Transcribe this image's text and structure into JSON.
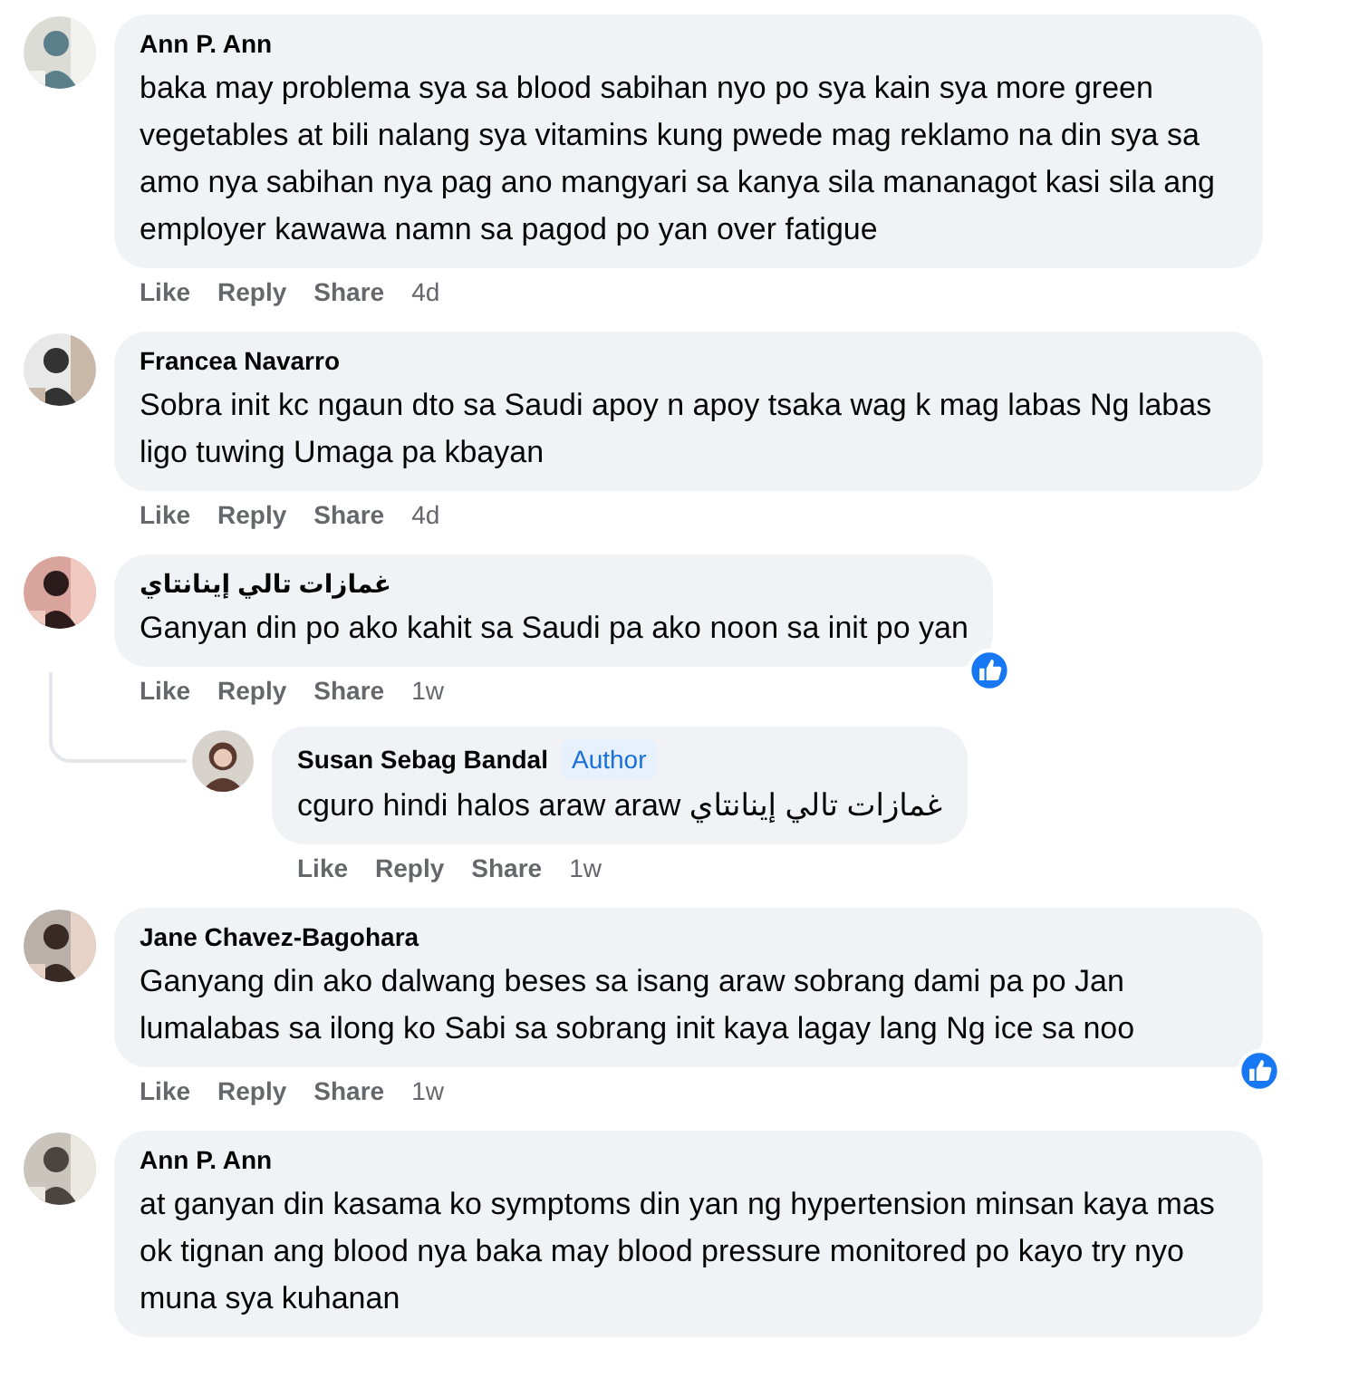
{
  "comments": [
    {
      "author": "Ann P. Ann",
      "text": "baka may problema sya sa blood sabihan nyo po sya kain sya more green vegetables at bili nalang sya vitamins kung pwede mag reklamo na din sya sa amo nya sabihan nya pag ano mangyari sa kanya sila mananagot kasi sila ang employer kawawa namn sa pagod po yan over fatigue",
      "actions": [
        "Like",
        "Reply",
        "Share"
      ],
      "time": "4d",
      "liked": false
    },
    {
      "author": "Francea Navarro",
      "text": "Sobra init kc ngaun dto sa Saudi apoy n apoy tsaka wag k mag labas Ng labas ligo tuwing Umaga pa kbayan",
      "actions": [
        "Like",
        "Reply",
        "Share"
      ],
      "time": "4d",
      "liked": false
    },
    {
      "author": "غمازات تالي إينانتاي",
      "text": "Ganyan din po ako kahit sa Saudi pa ako noon sa init po yan",
      "actions": [
        "Like",
        "Reply",
        "Share"
      ],
      "time": "1w",
      "liked": true,
      "replies": [
        {
          "author": "Susan Sebag Bandal",
          "badge": "Author",
          "text": "cguro hindi halos araw araw غمازات تالي إينانتاي",
          "actions": [
            "Like",
            "Reply",
            "Share"
          ],
          "time": "1w",
          "liked": false
        }
      ]
    },
    {
      "author": "Jane Chavez-Bagohara",
      "text": "Ganyang din ako dalwang beses sa isang araw sobrang dami pa po Jan lumalabas sa ilong ko Sabi sa sobrang init kaya lagay lang Ng ice sa noo",
      "actions": [
        "Like",
        "Reply",
        "Share"
      ],
      "time": "1w",
      "liked": true
    },
    {
      "author": "Ann P. Ann",
      "text": "at ganyan din kasama ko symptoms din yan ng hypertension minsan kaya mas ok tignan ang blood nya baka may blood pressure monitored po kayo try nyo muna sya kuhanan",
      "liked": false
    }
  ]
}
